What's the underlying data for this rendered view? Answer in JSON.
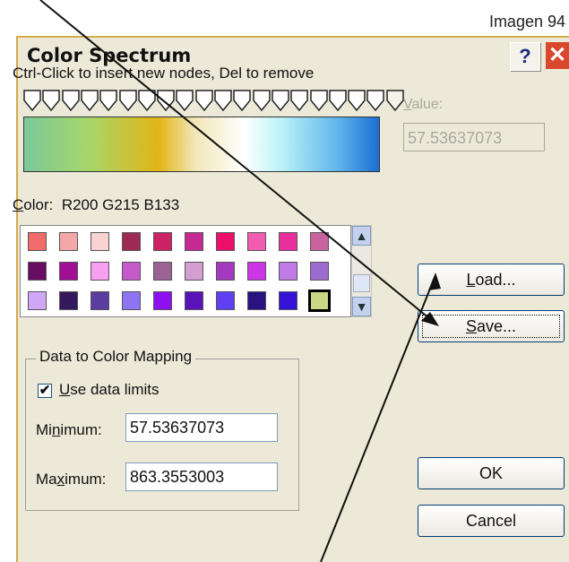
{
  "caption": "Imagen 94",
  "window": {
    "title": "Color Spectrum",
    "help_label": "?",
    "close_label": "✕"
  },
  "hint": "Ctrl-Click to insert new nodes, Del to remove",
  "value": {
    "label": "Value:",
    "field": "57.53637073"
  },
  "color": {
    "label_prefix": "C",
    "label_rest": "olor:",
    "rgb": "R200 G215 B133"
  },
  "swatch_rows": [
    [
      "#f26b6b",
      "#f3a7a7",
      "#fad2d2",
      "#9c2a55",
      "#cc2266",
      "#c62b93",
      "#ec0f6b",
      "#f15bb0",
      "#e92f9b",
      "#c9629f"
    ],
    [
      "#680d62",
      "#a10f95",
      "#f7a0f2",
      "#c45acb",
      "#9b6295",
      "#d49ed1",
      "#a33abf",
      "#ce35e6",
      "#c07ae6",
      "#9b6bd0"
    ],
    [
      "#d0a7f6",
      "#341a5c",
      "#5b3ca0",
      "#8e73f2",
      "#8e10f0",
      "#5a12b9",
      "#6140f4",
      "#2a1280",
      "#3611d6",
      "#c8d785"
    ]
  ],
  "scroll": {
    "up": "▲",
    "down": "▼"
  },
  "mapping": {
    "group_title": "Data to Color Mapping",
    "use_limits_checked": true,
    "check_mark": "✔",
    "use_limits_label_first": "U",
    "use_limits_label_rest": "se data limits",
    "min_label_a": "Mi",
    "min_label_b": "n",
    "min_label_c": "imum:",
    "min_value": "57.53637073",
    "max_label_a": "Ma",
    "max_label_b": "x",
    "max_label_c": "imum:",
    "max_value": "863.3553003"
  },
  "buttons": {
    "load_first": "L",
    "load_rest": "oad...",
    "save_first": "S",
    "save_rest": "ave...",
    "ok": "OK",
    "cancel": "Cancel"
  }
}
